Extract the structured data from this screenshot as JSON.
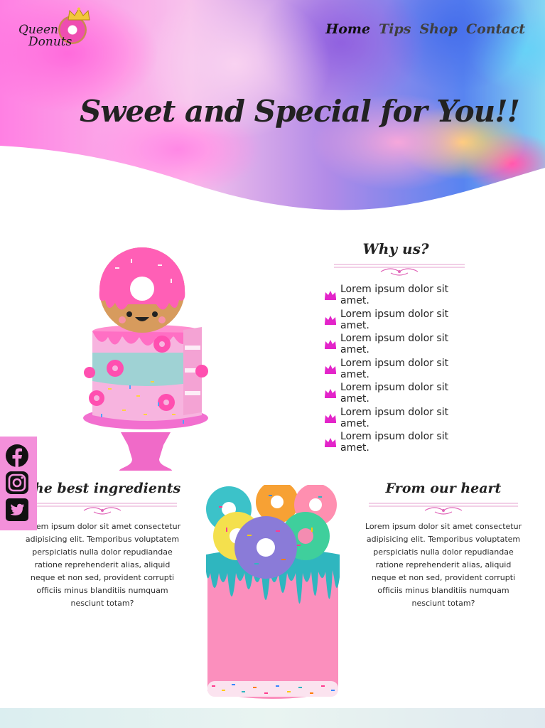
{
  "brand": {
    "logo_line1": "Queen",
    "logo_line2": "Donuts"
  },
  "nav": {
    "items": [
      {
        "label": "Home",
        "active": true
      },
      {
        "label": "Tips",
        "active": false
      },
      {
        "label": "Shop",
        "active": false
      },
      {
        "label": "Contact",
        "active": false
      }
    ]
  },
  "hero": {
    "title": "Sweet and Special for You!!"
  },
  "why_us": {
    "title": "Why us?",
    "items": [
      "Lorem ipsum dolor sit amet.",
      "Lorem ipsum dolor sit amet.",
      "Lorem ipsum dolor sit amet.",
      "Lorem ipsum dolor sit amet.",
      "Lorem ipsum dolor sit amet.",
      "Lorem ipsum dolor sit amet.",
      "Lorem ipsum dolor sit amet."
    ]
  },
  "ingredients": {
    "title": "The best ingredients",
    "text": "Lorem ipsum dolor sit amet consectetur adipisicing elit. Temporibus voluptatem perspiciatis nulla dolor repudiandae ratione reprehenderit alias, aliquid neque et non sed, provident corrupti officiis minus blanditiis numquam nesciunt totam?"
  },
  "heart": {
    "title": "From our heart",
    "text": "Lorem ipsum dolor sit amet consectetur adipisicing elit. Temporibus voluptatem perspiciatis nulla dolor repudiandae ratione reprehenderit alias, aliquid neque et non sed, provident corrupti officiis minus blanditiis numquam nesciunt totam?"
  },
  "social": {
    "icons": [
      "facebook-icon",
      "instagram-icon",
      "twitter-icon"
    ]
  },
  "colors": {
    "accent": "#e324c9",
    "sidebar": "#f390da",
    "text": "#222222"
  }
}
